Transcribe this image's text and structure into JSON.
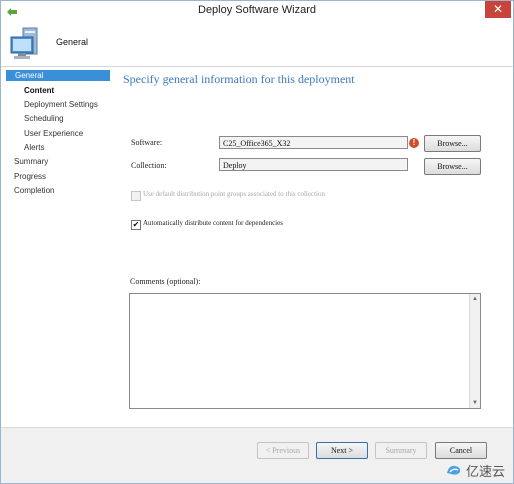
{
  "window": {
    "title": "Deploy Software Wizard",
    "close_glyph": "✕"
  },
  "header": {
    "title": "General"
  },
  "nav": {
    "items": [
      {
        "label": "General"
      },
      {
        "label": "Content"
      },
      {
        "label": "Deployment Settings"
      },
      {
        "label": "Scheduling"
      },
      {
        "label": "User Experience"
      },
      {
        "label": "Alerts"
      },
      {
        "label": "Summary"
      },
      {
        "label": "Progress"
      },
      {
        "label": "Completion"
      }
    ]
  },
  "page": {
    "heading": "Specify general information for this deployment",
    "software": {
      "label": "Software:",
      "value": "C25_Office365_X32",
      "browse": "Browse..."
    },
    "collection": {
      "label": "Collection:",
      "value": "Deploy",
      "browse": "Browse..."
    },
    "use_default_groups": {
      "label": "Use default distribution point groups associated to this collection",
      "checked": false
    },
    "auto_distribute": {
      "label": "Automatically distribute content for dependencies",
      "checked": true,
      "check_glyph": "✔"
    },
    "comments": {
      "label": "Comments (optional):",
      "value": ""
    }
  },
  "footer": {
    "previous": "< Previous",
    "next": "Next >",
    "summary": "Summary",
    "cancel": "Cancel"
  },
  "watermark": {
    "text": "亿速云"
  },
  "colors": {
    "accent": "#3a8fd9",
    "heading": "#3a7abf",
    "close": "#c8433a",
    "warning": "#d14d2a"
  }
}
